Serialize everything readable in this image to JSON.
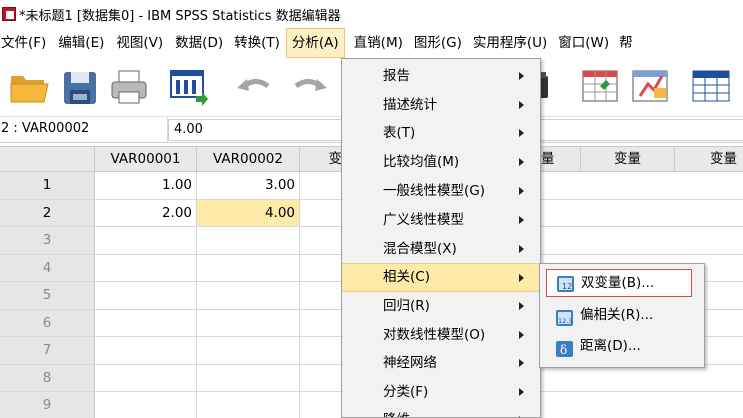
{
  "window": {
    "title": "*未标题1 [数据集0] - IBM SPSS Statistics 数据编辑器"
  },
  "menubar": {
    "items": [
      {
        "label": "文件(F)"
      },
      {
        "label": "编辑(E)"
      },
      {
        "label": "视图(V)"
      },
      {
        "label": "数据(D)"
      },
      {
        "label": "转换(T)"
      },
      {
        "label": "分析(A)"
      },
      {
        "label": "直销(M)"
      },
      {
        "label": "图形(G)"
      },
      {
        "label": "实用程序(U)"
      },
      {
        "label": "窗口(W)"
      },
      {
        "label": "帮"
      }
    ]
  },
  "toolbar": {
    "icons": [
      "open-folder-icon",
      "save-icon",
      "print-icon",
      "dialog-recall-icon",
      "undo-icon",
      "redo-icon",
      "find-icon",
      "insert-cases-icon",
      "insert-variable-icon",
      "split-file-icon"
    ]
  },
  "cellbar": {
    "cell_name": "2 : VAR00002",
    "cell_value": "4.00"
  },
  "grid": {
    "columns": [
      "VAR00001",
      "VAR00002",
      "变",
      "量",
      "变量",
      "变量"
    ],
    "rows": [
      {
        "num": "1",
        "v1": "1.00",
        "v2": "3.00"
      },
      {
        "num": "2",
        "v1": "2.00",
        "v2": "4.00"
      },
      {
        "num": "3",
        "v1": "",
        "v2": ""
      },
      {
        "num": "4",
        "v1": "",
        "v2": ""
      },
      {
        "num": "5",
        "v1": "",
        "v2": ""
      },
      {
        "num": "6",
        "v1": "",
        "v2": ""
      },
      {
        "num": "7",
        "v1": "",
        "v2": ""
      },
      {
        "num": "8",
        "v1": "",
        "v2": ""
      },
      {
        "num": "9",
        "v1": "",
        "v2": ""
      }
    ]
  },
  "analyze_menu": {
    "items": [
      {
        "label": "报告"
      },
      {
        "label": "描述统计"
      },
      {
        "label": "表(T)"
      },
      {
        "label": "比较均值(M)"
      },
      {
        "label": "一般线性模型(G)"
      },
      {
        "label": "广义线性模型"
      },
      {
        "label": "混合模型(X)"
      },
      {
        "label": "相关(C)"
      },
      {
        "label": "回归(R)"
      },
      {
        "label": "对数线性模型(O)"
      },
      {
        "label": "神经网络"
      },
      {
        "label": "分类(F)"
      },
      {
        "label": "降维"
      }
    ]
  },
  "correlate_submenu": {
    "items": [
      {
        "label": "双变量(B)...",
        "icon": "bivariate-icon"
      },
      {
        "label": "偏相关(R)...",
        "icon": "partial-correlation-icon"
      },
      {
        "label": "距离(D)...",
        "icon": "distances-icon"
      }
    ]
  },
  "colors": {
    "highlight": "#fde9a8",
    "focus_border": "#d94b4b",
    "menu_bg": "#f2f2f2"
  }
}
